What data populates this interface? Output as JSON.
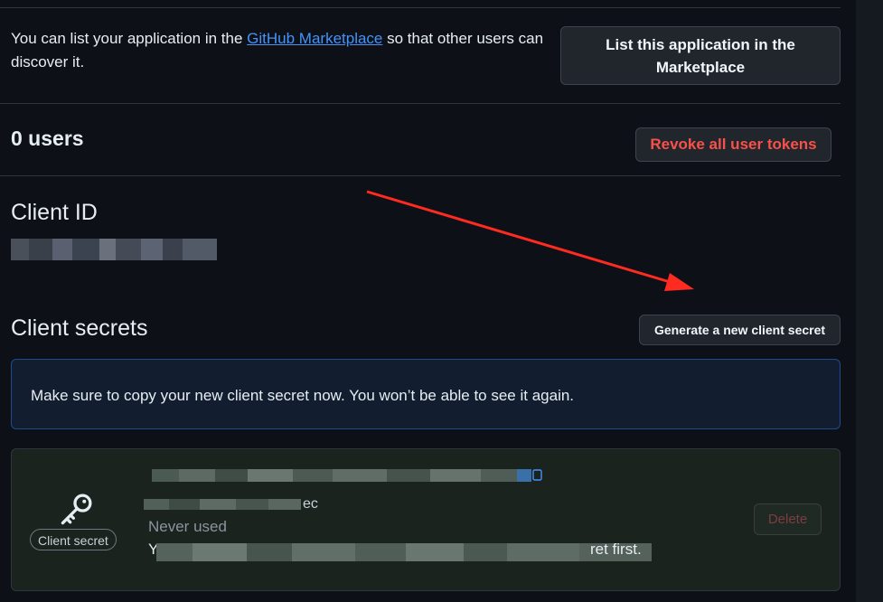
{
  "marketplace": {
    "text_before": "You can list your application in the ",
    "link": "GitHub Marketplace",
    "text_after": " so that other users can discover it.",
    "button": "List this application in the Marketplace"
  },
  "users": {
    "title": "0 users",
    "revoke_button": "Revoke all user tokens"
  },
  "client_id": {
    "title": "Client ID"
  },
  "client_secrets": {
    "title": "Client secrets",
    "generate_button": "Generate a new client secret",
    "flash_message": "Make sure to copy your new client secret now. You won’t be able to see it again.",
    "secret": {
      "badge": "Client secret",
      "suffix": "ec",
      "status": "Never used",
      "desc_prefix": "Yo",
      "desc_suffix": "ret first.",
      "delete_button": "Delete"
    }
  },
  "icons": [
    "key-icon",
    "copy-icon"
  ],
  "colors": {
    "background": "#0d1117",
    "danger": "#f85149",
    "link": "#4493f8",
    "annotation_arrow": "#ff2a20"
  }
}
